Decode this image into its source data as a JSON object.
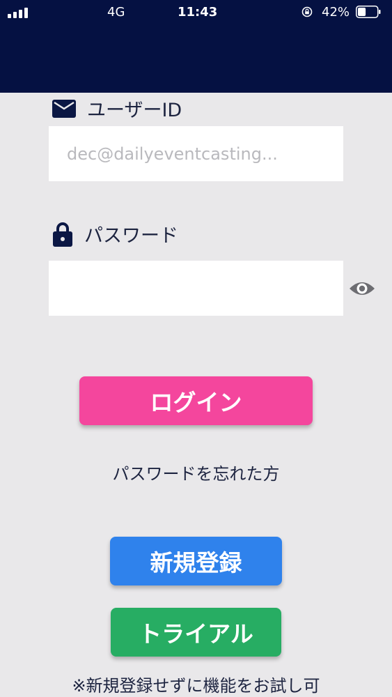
{
  "status_bar": {
    "network": "4G",
    "time": "11:43",
    "battery_percent": "42%",
    "battery_level": 0.42,
    "signal_bars": 4
  },
  "form": {
    "user_id_label": "ユーザーID",
    "user_id_placeholder": "dec@dailyeventcasting...",
    "password_label": "パスワード",
    "password_value": ""
  },
  "buttons": {
    "login": "ログイン",
    "forgot_password": "パスワードを忘れた方",
    "register": "新規登録",
    "trial": "トライアル"
  },
  "note": "※新規登録せずに機能をお試し可",
  "colors": {
    "header": "#051142",
    "login": "#f4469d",
    "register": "#2f82ec",
    "trial": "#27ad63"
  },
  "icons": {
    "user_id": "mail-icon",
    "password": "lock-icon",
    "show_password": "eye-icon"
  }
}
